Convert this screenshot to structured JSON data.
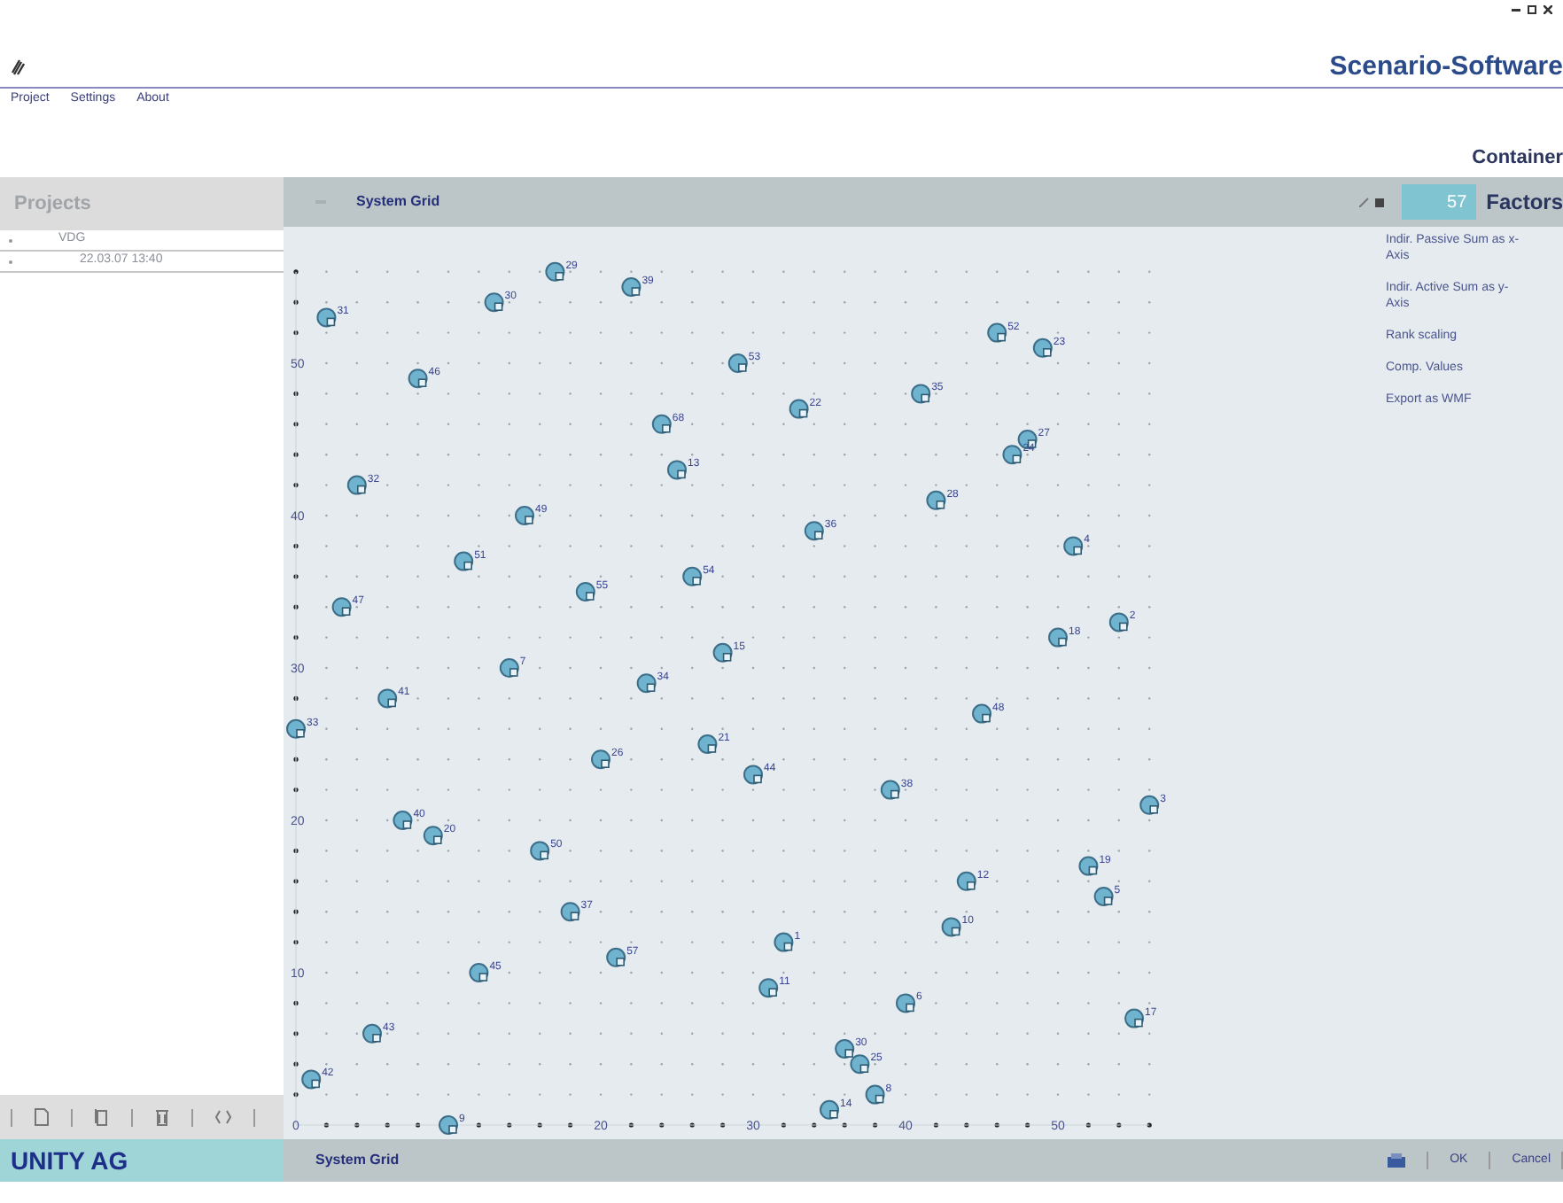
{
  "app": {
    "title": "Scenario-Software",
    "menu": [
      "Project",
      "Settings",
      "About"
    ],
    "container_label": "Container"
  },
  "projects": {
    "title": "Projects",
    "tree": [
      {
        "label": "VDG",
        "children": [
          {
            "label": "22.03.07 13:40"
          }
        ]
      }
    ]
  },
  "grid_panel": {
    "title": "System Grid",
    "count": "57",
    "count_label": "Factors",
    "options": [
      "Indir. Passive Sum as x-Axis",
      "Indir. Active Sum as y-Axis",
      "Rank scaling",
      "Comp. Values",
      "Export as WMF"
    ],
    "chart_data": {
      "type": "scatter",
      "xlim": [
        0,
        56
      ],
      "ylim": [
        0,
        56
      ],
      "xticks": [
        0,
        20,
        30,
        40,
        50
      ],
      "yticks": [
        10,
        20,
        30,
        40,
        50
      ],
      "x": [
        17,
        22,
        13,
        2,
        46,
        49,
        29,
        8,
        41,
        33,
        24,
        48,
        47,
        25,
        4,
        42,
        15,
        34,
        51,
        11,
        26,
        19,
        3,
        54,
        50,
        28,
        14,
        23,
        6,
        45,
        0,
        27,
        20,
        30,
        39,
        56,
        7,
        9,
        16,
        52,
        44,
        53,
        18,
        43,
        32,
        21,
        12,
        31,
        40,
        55,
        5,
        36,
        37,
        1,
        38,
        35,
        10
      ],
      "series": [
        {
          "color": "#6fb3cf",
          "values": [
            56,
            55,
            54,
            53,
            52,
            51,
            50,
            49,
            48,
            47,
            46,
            45,
            44,
            43,
            42,
            41,
            40,
            39,
            38,
            37,
            36,
            35,
            34,
            33,
            32,
            31,
            30,
            29,
            28,
            27,
            26,
            25,
            24,
            23,
            22,
            21,
            20,
            19,
            18,
            17,
            16,
            15,
            14,
            13,
            12,
            11,
            10,
            9,
            8,
            7,
            6,
            5,
            4,
            3,
            2,
            1,
            0
          ]
        }
      ],
      "value_labels": [
        "29",
        "39",
        "30",
        "31",
        "52",
        "23",
        "53",
        "46",
        "35",
        "22",
        "68",
        "27",
        "24",
        "13",
        "32",
        "28",
        "49",
        "36",
        "4",
        "51",
        "54",
        "55",
        "47",
        "2",
        "18",
        "15",
        "7",
        "34",
        "41",
        "48",
        "33",
        "21",
        "26",
        "44",
        "38",
        "3",
        "40",
        "20",
        "50",
        "19",
        "12",
        "5",
        "37",
        "10",
        "1",
        "57",
        "45",
        "11",
        "6",
        "17",
        "43",
        "30",
        "25",
        "42",
        "8",
        "14",
        "9"
      ]
    }
  },
  "footer": {
    "company": "UNITY AG",
    "status": "System Grid",
    "buttons": [
      "OK",
      "Cancel"
    ]
  }
}
